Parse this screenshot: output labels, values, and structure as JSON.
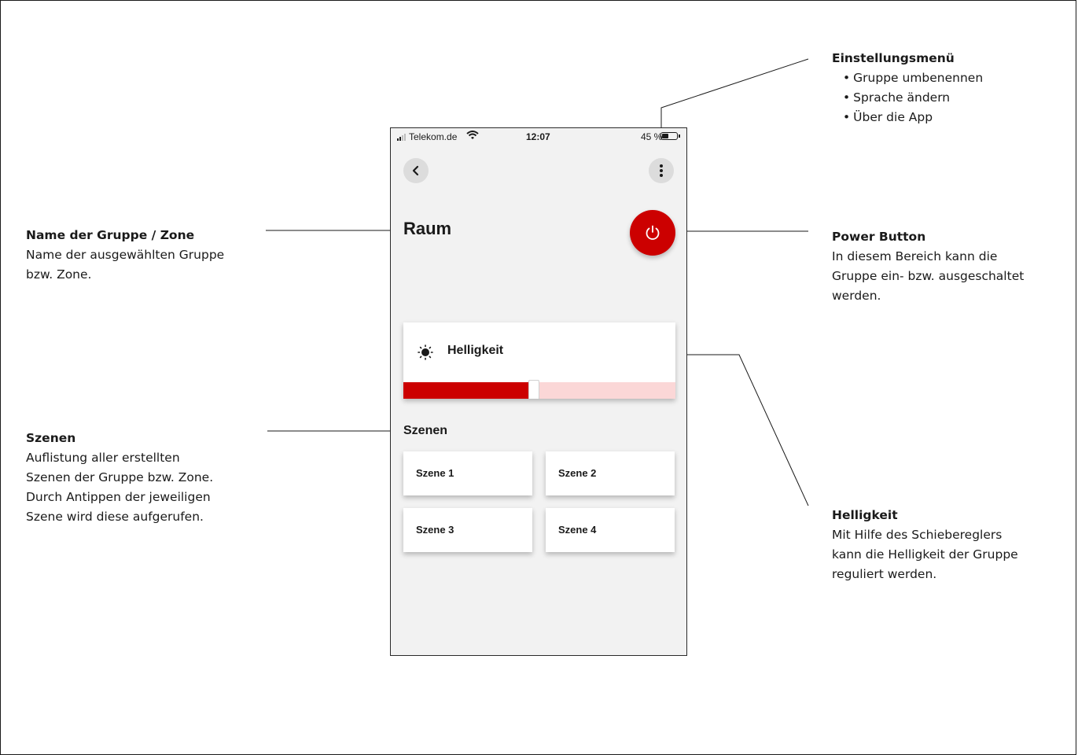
{
  "annotations": {
    "settings_menu": {
      "title": "Einstellungsmenü",
      "items": [
        "Gruppe umbenennen",
        "Sprache ändern",
        "Über die App"
      ]
    },
    "group_name": {
      "title": "Name der Gruppe / Zone",
      "lines": [
        "Name der ausgewählten Gruppe",
        "bzw. Zone."
      ]
    },
    "power_button": {
      "title": "Power Button",
      "lines": [
        "In diesem Bereich kann die",
        "Gruppe ein- bzw. ausgeschaltet",
        "werden."
      ]
    },
    "scenes": {
      "title": "Szenen",
      "lines": [
        "Auflistung aller erstellten",
        "Szenen der Gruppe bzw. Zone.",
        "Durch Antippen der jeweiligen",
        "Szene wird diese aufgerufen."
      ]
    },
    "brightness": {
      "title": "Helligkeit",
      "lines": [
        "Mit Hilfe des Schiebereglers",
        "kann die Helligkeit der Gruppe",
        "reguliert werden."
      ]
    }
  },
  "phone": {
    "status_bar": {
      "carrier": "Telekom.de",
      "time": "12:07",
      "battery": "45 %",
      "battery_level": 0.45
    },
    "icons": {
      "back": "chevron-left-icon",
      "menu": "more-vertical-icon",
      "power": "power-icon",
      "brightness": "sun-icon"
    },
    "room_title": "Raum",
    "brightness": {
      "label": "Helligkeit",
      "level_percent": 48
    },
    "scenes": {
      "heading": "Szenen",
      "items": [
        "Szene 1",
        "Szene 2",
        "Szene 3",
        "Szene 4"
      ]
    },
    "colors": {
      "accent": "#cc0000",
      "slider_track": "#fbd7d7",
      "background": "#f2f2f2"
    }
  }
}
